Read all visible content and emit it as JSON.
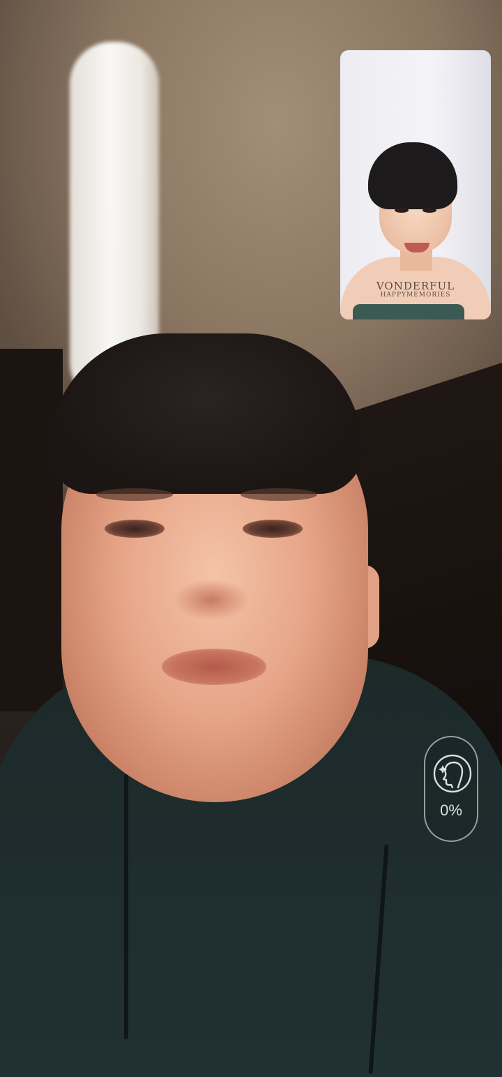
{
  "call": {
    "remote_video_label": "",
    "self_view": {
      "shirt_text_line1": "VONDERFUL",
      "shirt_text_line2": "HAPPYMEMORIES"
    },
    "beauty": {
      "icon": "face-beauty-icon",
      "level_percent": 0,
      "label": "0%"
    }
  },
  "colors": {
    "pill_border": "#ffffff",
    "pill_text": "#ffffff"
  }
}
